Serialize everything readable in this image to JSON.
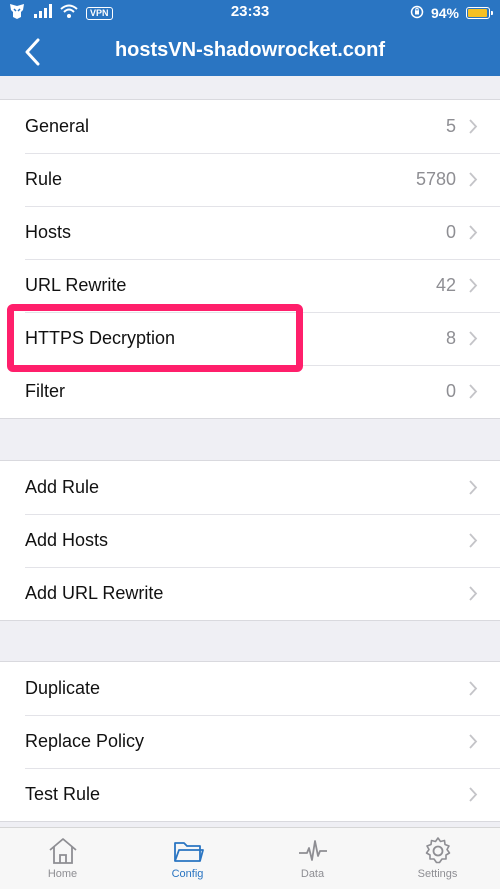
{
  "status_bar": {
    "time": "23:33",
    "vpn_label": "VPN",
    "battery_percent": "94%",
    "battery_level": 0.94
  },
  "nav": {
    "title": "hostsVN-shadowrocket.conf"
  },
  "sections": [
    {
      "rows": [
        {
          "label": "General",
          "value": "5"
        },
        {
          "label": "Rule",
          "value": "5780"
        },
        {
          "label": "Hosts",
          "value": "0"
        },
        {
          "label": "URL Rewrite",
          "value": "42"
        },
        {
          "label": "HTTPS Decryption",
          "value": "8"
        },
        {
          "label": "Filter",
          "value": "0"
        }
      ]
    },
    {
      "rows": [
        {
          "label": "Add Rule"
        },
        {
          "label": "Add Hosts"
        },
        {
          "label": "Add URL Rewrite"
        }
      ]
    },
    {
      "rows": [
        {
          "label": "Duplicate"
        },
        {
          "label": "Replace Policy"
        },
        {
          "label": "Test Rule"
        }
      ]
    }
  ],
  "highlighted_row": "HTTPS Decryption",
  "highlight_color": "#ff1f6b",
  "accent_color": "#2a75c2",
  "tabs": [
    {
      "label": "Home",
      "icon": "house-icon",
      "active": false
    },
    {
      "label": "Config",
      "icon": "folder-icon",
      "active": true
    },
    {
      "label": "Data",
      "icon": "pulse-icon",
      "active": false
    },
    {
      "label": "Settings",
      "icon": "gear-icon",
      "active": false
    }
  ]
}
